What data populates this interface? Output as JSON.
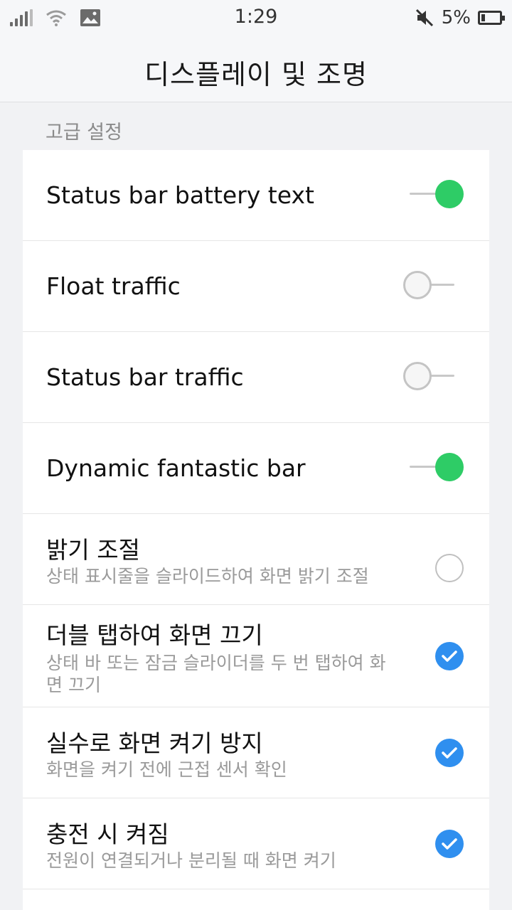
{
  "status_bar": {
    "time": "1:29",
    "battery_text": "5%"
  },
  "header": {
    "title": "디스플레이 및 조명"
  },
  "section": {
    "label": "고급 설정"
  },
  "settings": [
    {
      "title": "Status bar battery text",
      "control": "switch",
      "on": true
    },
    {
      "title": "Float traffic",
      "control": "switch",
      "on": false
    },
    {
      "title": "Status bar traffic",
      "control": "switch",
      "on": false
    },
    {
      "title": "Dynamic fantastic bar",
      "control": "switch",
      "on": true
    },
    {
      "title": "밝기 조절",
      "subtitle": "상태 표시줄을 슬라이드하여 화면 밝기 조절",
      "control": "checkbox",
      "on": false
    },
    {
      "title": "더블 탭하여 화면 끄기",
      "subtitle": "상태 바 또는 잠금 슬라이더를 두 번 탭하여 화면 끄기",
      "control": "checkbox",
      "on": true
    },
    {
      "title": "실수로 화면 켜기 방지",
      "subtitle": "화면을 켜기 전에 근접 센서 확인",
      "control": "checkbox",
      "on": true
    },
    {
      "title": "충전 시 켜짐",
      "subtitle": "전원이 연결되거나 분리될 때 화면 켜기",
      "control": "checkbox",
      "on": true
    }
  ],
  "colors": {
    "switch_on": "#2ecc66",
    "check_on": "#2f8fef"
  }
}
